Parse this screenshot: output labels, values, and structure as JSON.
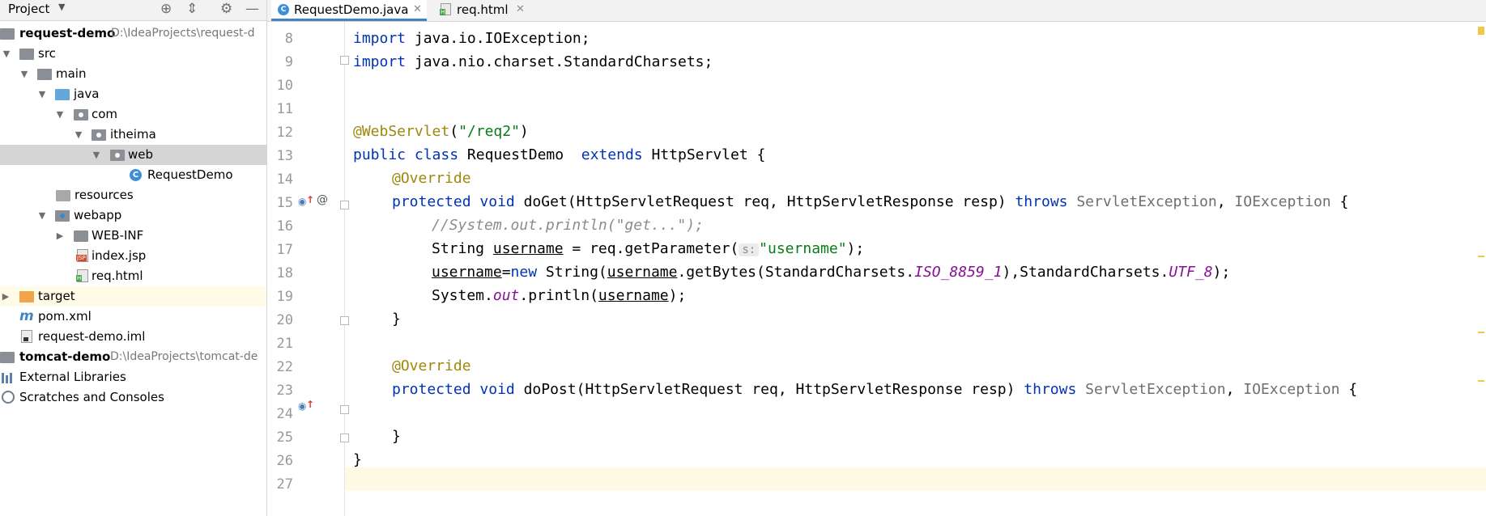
{
  "project_panel": {
    "title": "Project",
    "dropdown_icon": "chevron-down-icon",
    "toolbar_icons": [
      "locate-icon",
      "collapse-all-icon",
      "settings-icon",
      "minimize-icon"
    ],
    "tree": [
      {
        "label": "request-demo",
        "path": "D:\\IdeaProjects\\request-d"
      },
      {
        "label": "src"
      },
      {
        "label": "main"
      },
      {
        "label": "java"
      },
      {
        "label": "com"
      },
      {
        "label": "itheima"
      },
      {
        "label": "web"
      },
      {
        "label": "RequestDemo"
      },
      {
        "label": "resources"
      },
      {
        "label": "webapp"
      },
      {
        "label": "WEB-INF"
      },
      {
        "label": "index.jsp"
      },
      {
        "label": "req.html"
      },
      {
        "label": "target"
      },
      {
        "label": "pom.xml"
      },
      {
        "label": "request-demo.iml"
      },
      {
        "label": "tomcat-demo",
        "path": "D:\\IdeaProjects\\tomcat-de"
      },
      {
        "label": "External Libraries"
      },
      {
        "label": "Scratches and Consoles"
      }
    ]
  },
  "editor": {
    "tabs": [
      {
        "label": "RequestDemo.java",
        "icon": "java-class-icon",
        "active": true
      },
      {
        "label": "req.html",
        "icon": "html-file-icon",
        "active": false
      }
    ],
    "line_numbers": [
      "8",
      "9",
      "10",
      "11",
      "12",
      "13",
      "14",
      "15",
      "16",
      "17",
      "18",
      "19",
      "20",
      "21",
      "22",
      "23",
      "24",
      "25",
      "26",
      "27"
    ],
    "code": {
      "l8": {
        "kw": "import",
        "rest": " java.io.IOException;"
      },
      "l9": {
        "kw": "import",
        "rest": " java.nio.charset.StandardCharsets;"
      },
      "l12": {
        "ann": "@WebServlet",
        "open": "(",
        "str": "\"/req2\"",
        "close": ")"
      },
      "l13": {
        "kw1": "public",
        "kw2": "class",
        "name": " RequestDemo  ",
        "kw3": "extends",
        "rest": " HttpServlet {"
      },
      "l14": {
        "ann": "@Override"
      },
      "l15": {
        "kw1": "protected",
        "kw2": "void",
        "mid": " doGet(HttpServletRequest req, HttpServletResponse resp) ",
        "kw3": "throws",
        "exc1": "ServletException",
        "comma": ", ",
        "exc2": "IOException",
        "end": " {"
      },
      "l16": {
        "cmt": "//System.out.println(\"get...\");"
      },
      "l17": {
        "pre": "String ",
        "var": "username",
        "mid": " = req.getParameter(",
        "hint": "s:",
        "str": "\"username\"",
        "end": ");"
      },
      "l18": {
        "var1": "username",
        "eq": "=",
        "kw": "new",
        "a": " String(",
        "var2": "username",
        "b": ".getBytes(StandardCharsets.",
        "c1": "ISO_8859_1",
        "d": "),StandardCharsets.",
        "c2": "UTF_8",
        "e": ");"
      },
      "l19": {
        "a": "System.",
        "out": "out",
        "b": ".println(",
        "var": "username",
        "c": ");"
      },
      "l20": {
        "t": "}"
      },
      "l22": {
        "ann": "@Override"
      },
      "l23": {
        "kw1": "protected",
        "kw2": "void",
        "mid": " doPost(HttpServletRequest req, HttpServletResponse resp) ",
        "kw3": "throws",
        "exc1": "ServletException",
        "comma": ", ",
        "exc2": "IOException",
        "end": " {"
      },
      "l25": {
        "t": "}"
      },
      "l26": {
        "t": "}"
      }
    },
    "gutter_icons": {
      "line15": [
        "override-icon",
        "up-arrow-icon",
        "at-icon"
      ],
      "line23": [
        "override-icon",
        "up-arrow-icon"
      ],
      "at_glyph": "@",
      "arrow_glyph": "↑"
    }
  }
}
